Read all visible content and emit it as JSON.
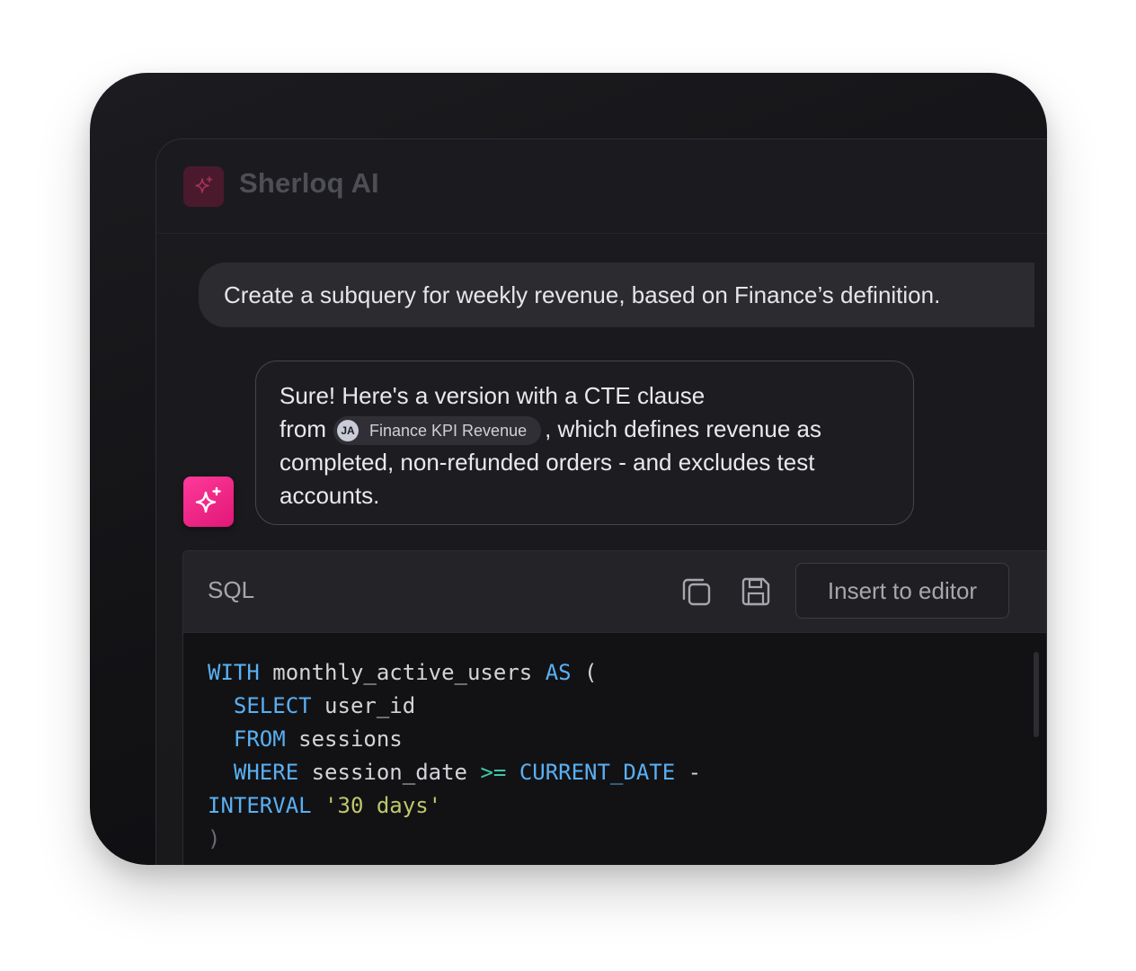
{
  "app": {
    "title": "Sherloq AI"
  },
  "chat": {
    "user_message": "Create a subquery for weekly revenue, based on Finance’s definition.",
    "ai_message": {
      "part1": "Sure! Here's a version with a CTE clause",
      "part2": "from",
      "chip": {
        "avatar_initials": "JA",
        "label": "Finance KPI Revenue"
      },
      "part3": ", which defines revenue as completed, non-refunded orders - and excludes test accounts."
    }
  },
  "code_block": {
    "language_label": "SQL",
    "copy_icon": "copy-icon",
    "save_icon": "save-icon",
    "insert_button_label": "Insert to editor",
    "lines": [
      [
        {
          "t": "kw",
          "v": "WITH"
        },
        {
          "t": "",
          "v": " monthly_active_users "
        },
        {
          "t": "kw",
          "v": "AS"
        },
        {
          "t": "",
          "v": " ("
        }
      ],
      [
        {
          "t": "",
          "v": "  "
        },
        {
          "t": "kw",
          "v": "SELECT"
        },
        {
          "t": "",
          "v": " user_id"
        }
      ],
      [
        {
          "t": "",
          "v": "  "
        },
        {
          "t": "kw",
          "v": "FROM"
        },
        {
          "t": "",
          "v": " sessions"
        }
      ],
      [
        {
          "t": "",
          "v": "  "
        },
        {
          "t": "kw",
          "v": "WHERE"
        },
        {
          "t": "",
          "v": " session_date "
        },
        {
          "t": "op",
          "v": ">="
        },
        {
          "t": "",
          "v": " "
        },
        {
          "t": "kw",
          "v": "CURRENT_DATE"
        },
        {
          "t": "",
          "v": " -"
        }
      ],
      [
        {
          "t": "kw",
          "v": "INTERVAL"
        },
        {
          "t": "",
          "v": " "
        },
        {
          "t": "str",
          "v": "'30 days'"
        }
      ],
      [
        {
          "t": "dim",
          "v": ")"
        }
      ]
    ]
  },
  "colors": {
    "accent_pink": "#e81f7f",
    "keyword_blue": "#5ab0f2",
    "operator_teal": "#42c7a6",
    "string_olive": "#bfc76a"
  }
}
